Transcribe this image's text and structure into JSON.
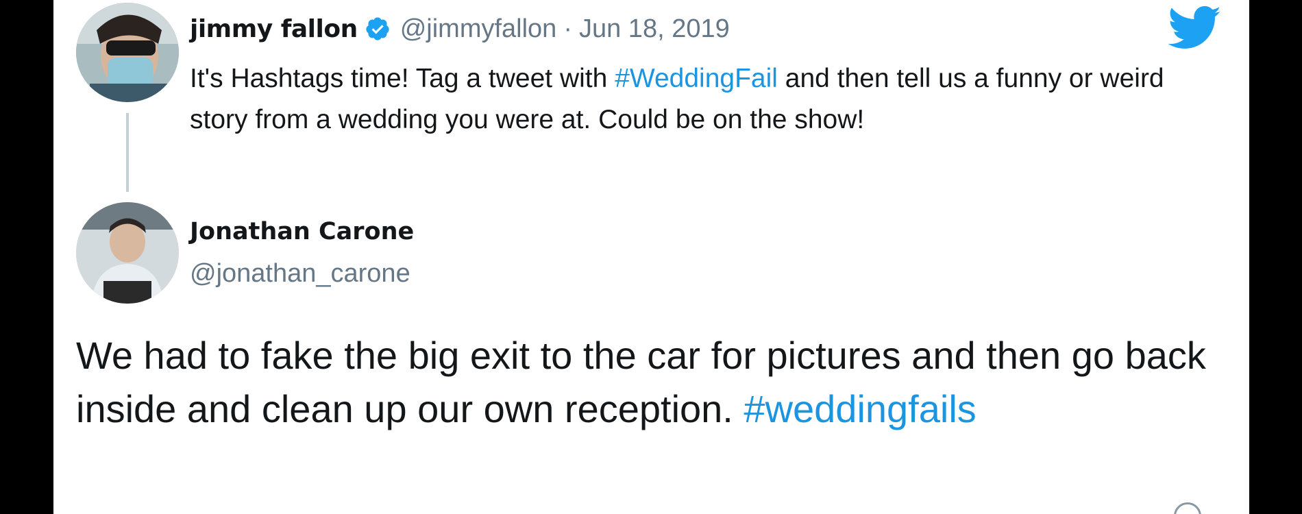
{
  "parent_tweet": {
    "display_name": "jimmy fallon",
    "handle": "@jimmyfallon",
    "separator": "·",
    "date": "Jun 18, 2019",
    "text_before": "It's Hashtags time! Tag a tweet with ",
    "hashtag": "#WeddingFail",
    "text_after": " and then tell us a funny or weird story from a wedding you were at. Could be on the show!",
    "avatar_icon": "user-avatar-photo",
    "verified_icon": "verified-badge-icon",
    "brand_icon": "twitter-bird-icon"
  },
  "reply_tweet": {
    "display_name": "Jonathan Carone",
    "handle": "@jonathan_carone",
    "text": "We had to fake the big exit to the car for pictures and then go back inside and clean up our own reception. ",
    "hashtag": "#weddingfails",
    "avatar_icon": "user-avatar-photo",
    "info_icon": "info-icon"
  },
  "colors": {
    "link": "#1b95e0",
    "text": "#14171a",
    "secondary": "#657786",
    "twitter_blue": "#1da1f2"
  }
}
